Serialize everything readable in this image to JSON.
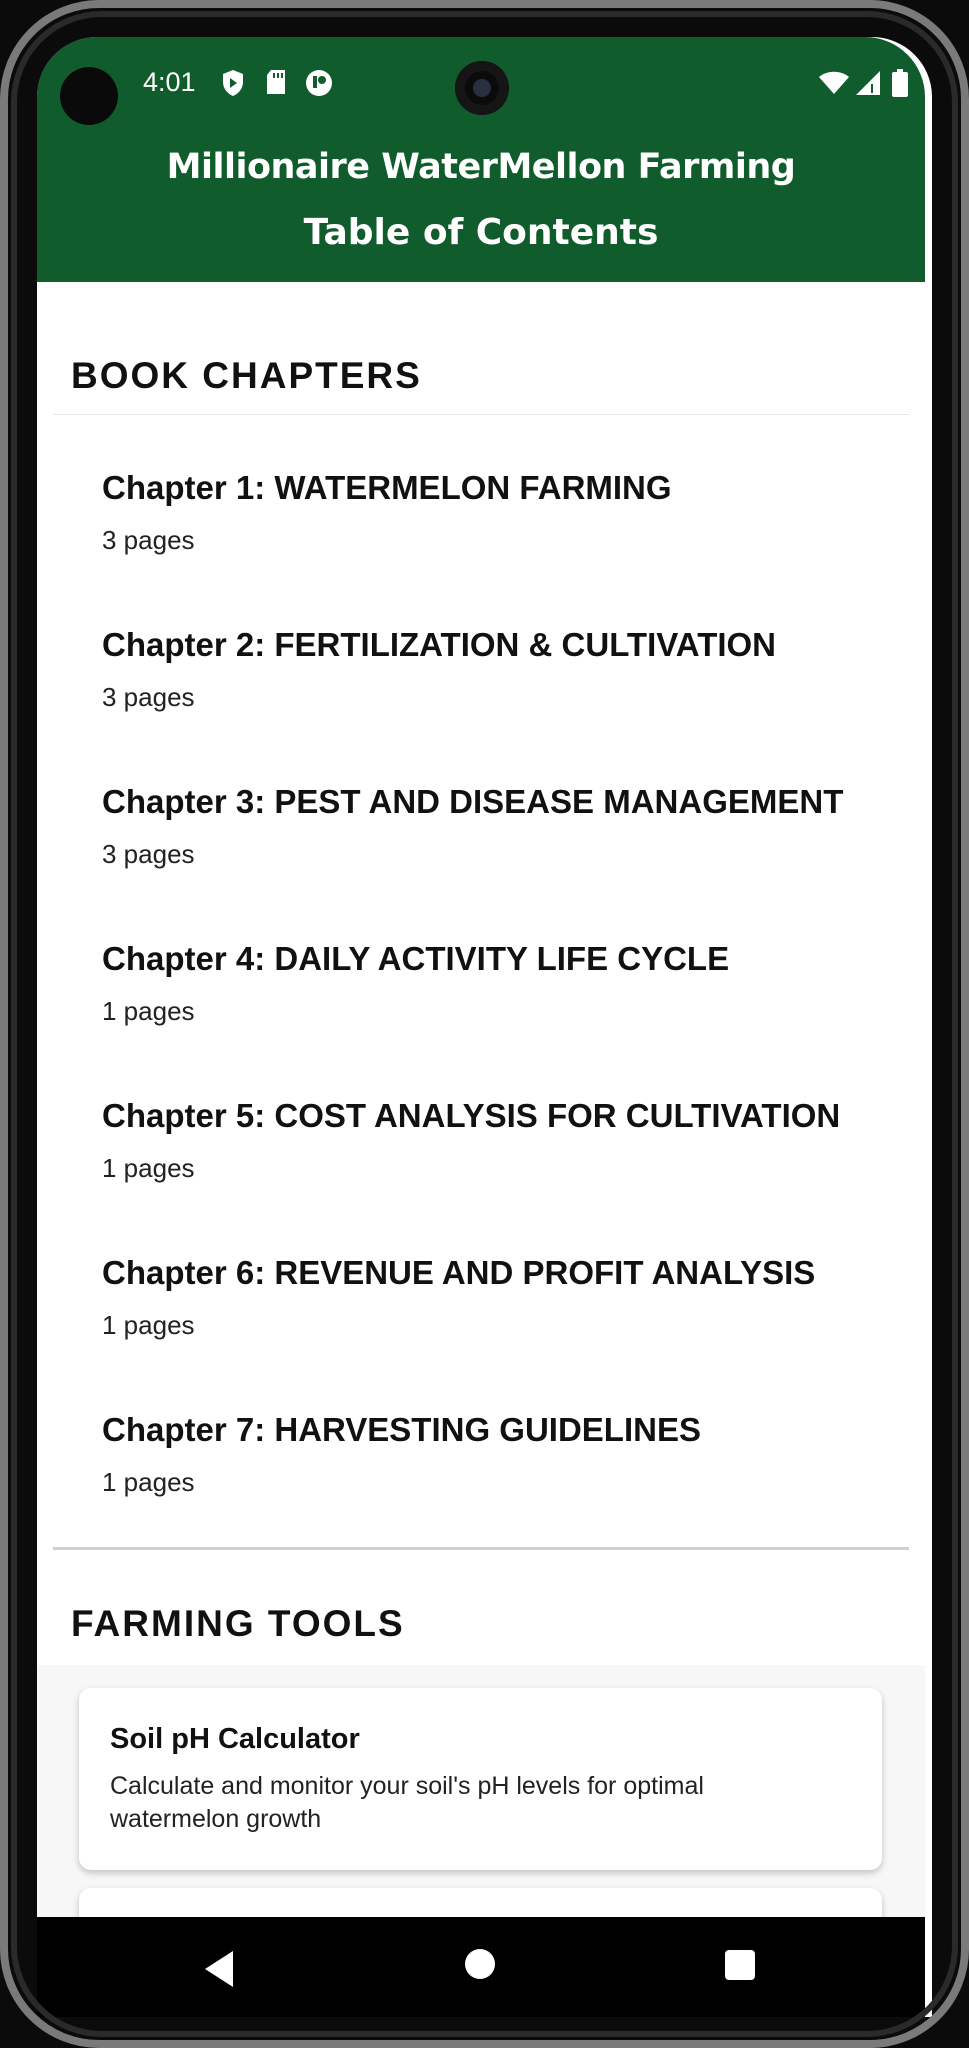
{
  "status_bar": {
    "time": "4:01",
    "left_icons": [
      "shield-icon",
      "sd-card-icon",
      "notification-app-icon"
    ],
    "right_icons": [
      "wifi-icon",
      "cell-signal-icon",
      "battery-icon"
    ]
  },
  "header": {
    "title": "Millionaire WaterMellon Farming",
    "subtitle": "Table of Contents",
    "color": "#115c2c"
  },
  "book_chapters": {
    "heading": "BOOK CHAPTERS",
    "items": [
      {
        "title": "Chapter 1: WATERMELON FARMING",
        "pages": "3 pages"
      },
      {
        "title": "Chapter 2: FERTILIZATION & CULTIVATION",
        "pages": "3 pages"
      },
      {
        "title": "Chapter 3: PEST AND DISEASE MANAGEMENT",
        "pages": "3 pages"
      },
      {
        "title": "Chapter 4: DAILY ACTIVITY LIFE CYCLE",
        "pages": "1 pages"
      },
      {
        "title": "Chapter 5: COST ANALYSIS FOR CULTIVATION",
        "pages": "1 pages"
      },
      {
        "title": "Chapter 6: REVENUE AND PROFIT ANALYSIS",
        "pages": "1 pages"
      },
      {
        "title": "Chapter 7: HARVESTING GUIDELINES",
        "pages": "1 pages"
      }
    ]
  },
  "farming_tools": {
    "heading": "FARMING TOOLS",
    "items": [
      {
        "title": "Soil pH Calculator",
        "description": "Calculate and monitor your soil's pH levels for optimal watermelon growth"
      }
    ]
  },
  "nav_bar": {
    "icons": [
      "back-icon",
      "home-icon",
      "recents-icon"
    ]
  }
}
